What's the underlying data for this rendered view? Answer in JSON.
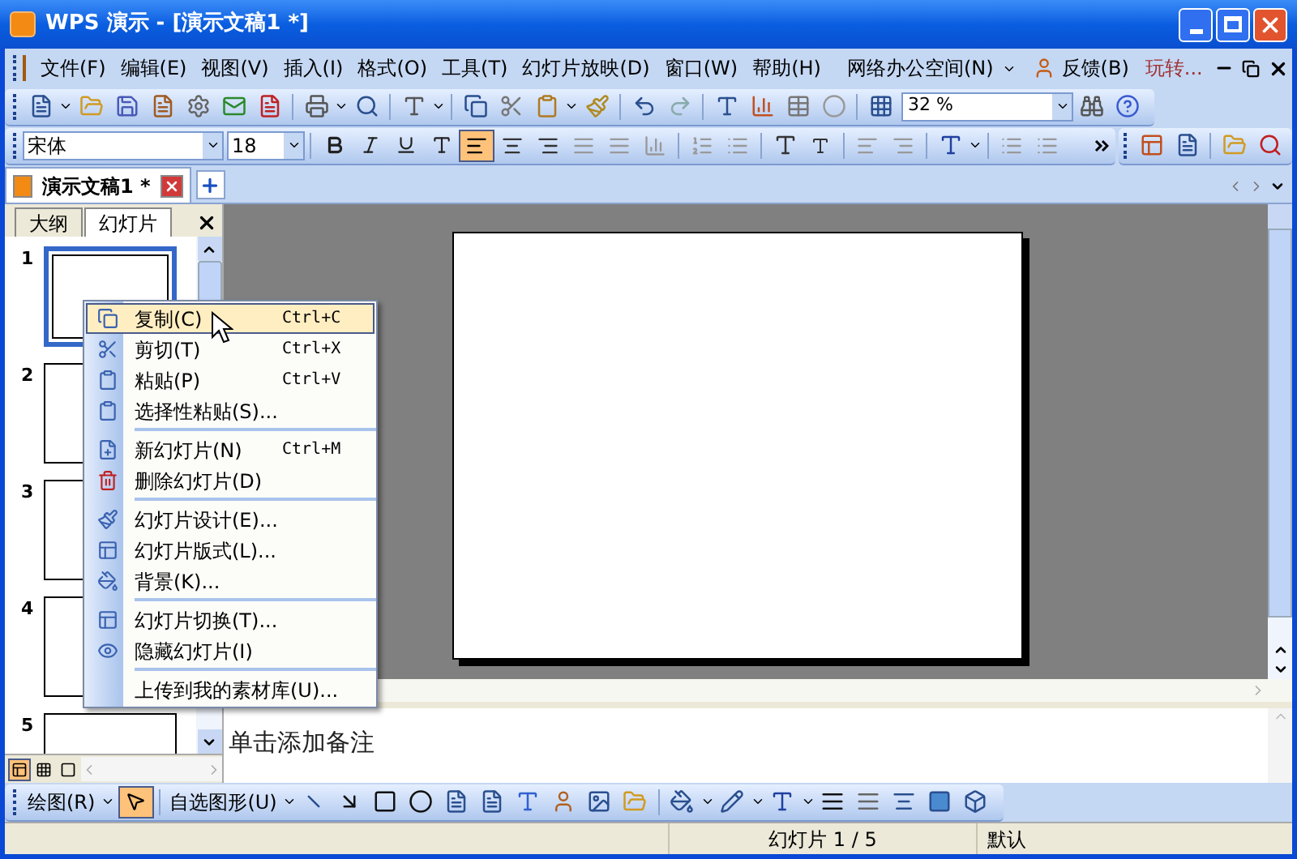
{
  "window": {
    "title": "WPS 演示 - [演示文稿1 *]"
  },
  "menu_bar": {
    "items": [
      "文件(F)",
      "编辑(E)",
      "视图(V)",
      "插入(I)",
      "格式(O)",
      "工具(T)",
      "幻灯片放映(D)",
      "窗口(W)",
      "帮助(H)"
    ],
    "network": "网络办公空间(N)",
    "feedback": "反馈(B)",
    "promo": "玩转..."
  },
  "format_toolbar": {
    "font": "宋体",
    "size": "18"
  },
  "standard_toolbar": {
    "zoom": "32 %"
  },
  "document_tabs": [
    {
      "label": "演示文稿1 *",
      "selected": true
    }
  ],
  "side_panel": {
    "tabs": [
      {
        "label": "大纲",
        "selected": false
      },
      {
        "label": "幻灯片",
        "selected": true
      }
    ],
    "slides": [
      {
        "number": "1",
        "selected": true
      },
      {
        "number": "2",
        "selected": false
      },
      {
        "number": "3",
        "selected": false
      },
      {
        "number": "4",
        "selected": false
      },
      {
        "number": "5",
        "selected": false
      }
    ]
  },
  "context_menu": [
    {
      "kind": "item",
      "label": "复制(C)",
      "shortcut": "Ctrl+C",
      "selected": true
    },
    {
      "kind": "item",
      "label": "剪切(T)",
      "shortcut": "Ctrl+X",
      "selected": false
    },
    {
      "kind": "item",
      "label": "粘贴(P)",
      "shortcut": "Ctrl+V",
      "selected": false
    },
    {
      "kind": "item",
      "label": "选择性粘贴(S)...",
      "selected": false
    },
    {
      "kind": "separator"
    },
    {
      "kind": "item",
      "label": "新幻灯片(N)",
      "shortcut": "Ctrl+M",
      "selected": false
    },
    {
      "kind": "item",
      "label": "删除幻灯片(D)",
      "selected": false
    },
    {
      "kind": "separator"
    },
    {
      "kind": "item",
      "label": "幻灯片设计(E)...",
      "selected": false
    },
    {
      "kind": "item",
      "label": "幻灯片版式(L)...",
      "selected": false
    },
    {
      "kind": "item",
      "label": "背景(K)...",
      "selected": false
    },
    {
      "kind": "separator"
    },
    {
      "kind": "item",
      "label": "幻灯片切换(T)...",
      "selected": false
    },
    {
      "kind": "item",
      "label": "隐藏幻灯片(I)",
      "selected": false
    },
    {
      "kind": "separator"
    },
    {
      "kind": "item",
      "label": "上传到我的素材库(U)...",
      "selected": false
    }
  ],
  "notes": {
    "placeholder": "单击添加备注"
  },
  "drawing_toolbar": {
    "draw": "绘图(R)",
    "autoshapes": "自选图形(U)"
  },
  "status_bar": {
    "slide": "幻灯片 1 / 5",
    "design": "默认"
  }
}
